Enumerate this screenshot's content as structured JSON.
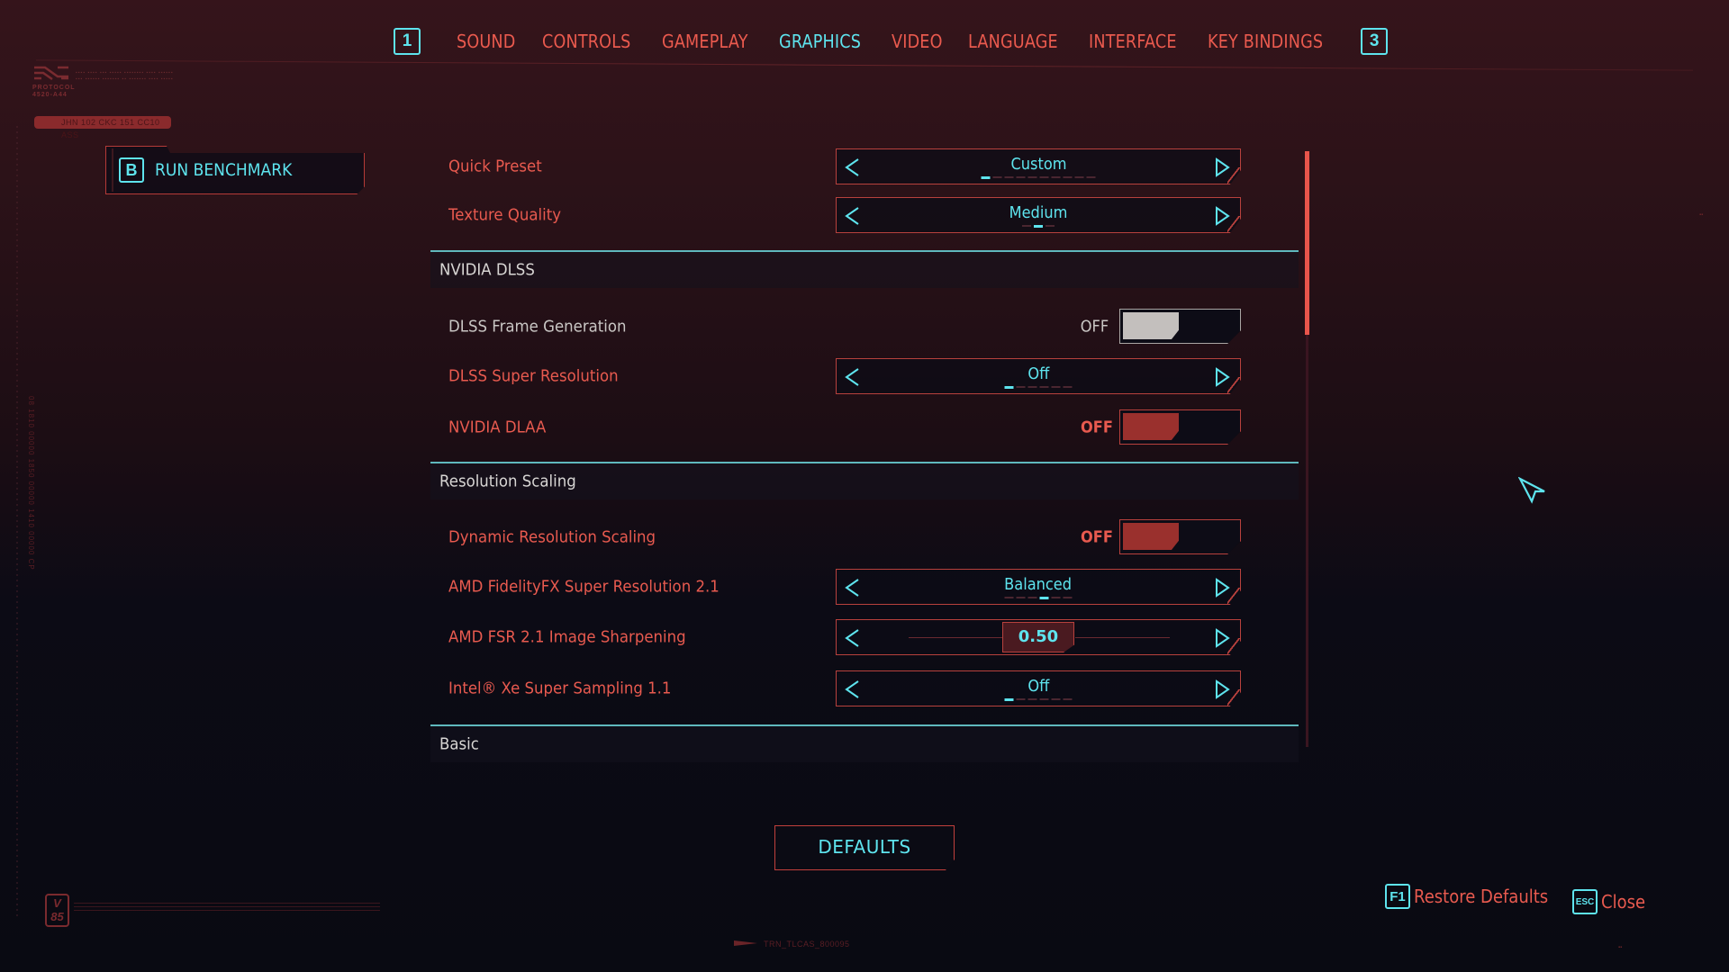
{
  "header": {
    "left_key": "1",
    "right_key": "3",
    "tabs": [
      {
        "label": "SOUND",
        "active": false
      },
      {
        "label": "CONTROLS",
        "active": false
      },
      {
        "label": "GAMEPLAY",
        "active": false
      },
      {
        "label": "GRAPHICS",
        "active": true
      },
      {
        "label": "VIDEO",
        "active": false
      },
      {
        "label": "LANGUAGE",
        "active": false
      },
      {
        "label": "INTERFACE",
        "active": false
      },
      {
        "label": "KEY BINDINGS",
        "active": false
      }
    ]
  },
  "deco": {
    "protocol": "PROTOCOL\n4520-A44",
    "pill_code": "JHN 102 CKC 151 CC10 ASS",
    "vertical_code": "08 1810 00000 1850 00000 1410 00000 CP",
    "version_badge": "V\n85",
    "trn_code": "TRN_TLCAS_800095"
  },
  "benchmark": {
    "key": "B",
    "label": "RUN BENCHMARK"
  },
  "settings": {
    "quick_preset": {
      "label": "Quick Preset",
      "value": "Custom",
      "segments": 10,
      "selected": 0
    },
    "texture_quality": {
      "label": "Texture Quality",
      "value": "Medium",
      "segments": 3,
      "selected": 1
    },
    "sections": {
      "dlss": "NVIDIA DLSS",
      "resolution_scaling": "Resolution Scaling",
      "basic": "Basic"
    },
    "dlss_frame_generation": {
      "label": "DLSS Frame Generation",
      "state": "OFF",
      "enabled": false
    },
    "dlss_super_resolution": {
      "label": "DLSS Super Resolution",
      "value": "Off",
      "segments": 6,
      "selected": 0
    },
    "nvidia_dlaa": {
      "label": "NVIDIA DLAA",
      "state": "OFF",
      "enabled": true
    },
    "dynamic_resolution_scaling": {
      "label": "Dynamic Resolution Scaling",
      "state": "OFF",
      "enabled": true
    },
    "amd_fsr": {
      "label": "AMD FidelityFX Super Resolution 2.1",
      "value": "Balanced",
      "segments": 6,
      "selected": 3
    },
    "fsr_sharpening": {
      "label": "AMD FSR 2.1 Image Sharpening",
      "value": "0.50",
      "fraction": 0.5
    },
    "xess": {
      "label": "Intel® Xe Super Sampling 1.1",
      "value": "Off",
      "segments": 6,
      "selected": 0
    }
  },
  "scroll": {
    "position": "top"
  },
  "footer": {
    "defaults_label": "DEFAULTS",
    "restore_key": "F1",
    "restore_label": "Restore Defaults",
    "close_key": "ESC",
    "close_label": "Close"
  },
  "colors": {
    "accent_cyan": "#5ee4ee",
    "accent_red": "#e85a4f",
    "section_line": "#5fb8bd"
  }
}
